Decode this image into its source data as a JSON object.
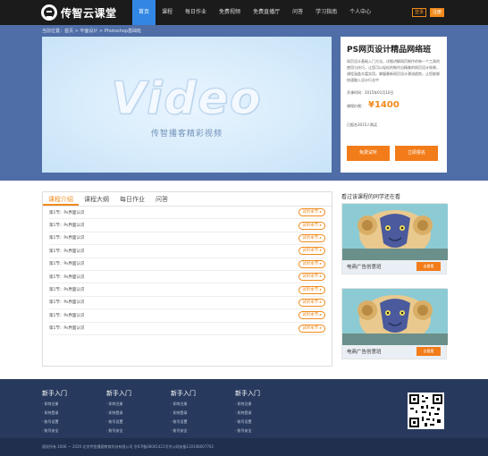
{
  "brand": {
    "name": "传智云课堂"
  },
  "nav": {
    "items": [
      "首页",
      "课程",
      "每日作业",
      "免费视频",
      "免费直播厅",
      "问答",
      "学习指南",
      "个人中心"
    ],
    "active_index": 0,
    "login_label": "登录",
    "register_label": "注册"
  },
  "breadcrumb": "当前位置：首页 > 平面设计 > Photoshop基础班",
  "video": {
    "title": "Video",
    "subtitle": "传智播客精彩视频"
  },
  "course": {
    "title": "PS网页设计精品网络班",
    "description": "网页设计基础入门方法，详细讲解网页制作的每一个工具的使用与技巧，让您可以轻松的制作出精美的网页设计效果，课程涵盖丰富实用，掌握最新网页设计潮流趋势，让您能够快速融入设计行业中",
    "date_label": "开课时间：2015年01月10日",
    "price_label": "课程价格：",
    "price": "¥1400",
    "enrolled": "已报名3015人购买",
    "free_trial_label": "免费试听",
    "enroll_label": "立即报名"
  },
  "tabs": [
    "课程介绍",
    "课程大纲",
    "每日作业",
    "问答"
  ],
  "active_tab": 0,
  "lessons": [
    {
      "title": "第1节：Ps界面认识",
      "action": "试听本节 ▸"
    },
    {
      "title": "第1节：Ps界面认识",
      "action": "试听本节 ▸"
    },
    {
      "title": "第1节：Ps界面认识",
      "action": "试听本节 ▸"
    },
    {
      "title": "第1节：Ps界面认识",
      "action": "试听本节 ▸"
    },
    {
      "title": "第1节：Ps界面认识",
      "action": "试听本节 ▸"
    },
    {
      "title": "第1节：Ps界面认识",
      "action": "试听本节 ▸"
    },
    {
      "title": "第1节：Ps界面认识",
      "action": "试听本节 ▸"
    },
    {
      "title": "第1节：Ps界面认识",
      "action": "试听本节 ▸"
    },
    {
      "title": "第1节：Ps界面认识",
      "action": "试听本节 ▸"
    },
    {
      "title": "第1节：Ps界面认识",
      "action": "试听本节 ▸"
    }
  ],
  "sidebar": {
    "title": "看过该课程的同学还在看",
    "cards": [
      {
        "caption": "电商广告创意班",
        "button": "去看看"
      },
      {
        "caption": "电商广告创意班",
        "button": "去看看"
      }
    ]
  },
  "footer": {
    "columns": [
      {
        "title": "新手入门",
        "items": [
          "如何注册",
          "如何登录",
          "账号设置",
          "账号安全"
        ]
      },
      {
        "title": "新手入门",
        "items": [
          "如何注册",
          "如何登录",
          "账号设置",
          "账号安全"
        ]
      },
      {
        "title": "新手入门",
        "items": [
          "如何注册",
          "如何登录",
          "账号设置",
          "账号安全"
        ]
      },
      {
        "title": "新手入门",
        "items": [
          "如何注册",
          "如何登录",
          "账号设置",
          "账号安全"
        ]
      }
    ],
    "copyright": "版权所有 2006 — 2020 北京传智播客教育科技有限公司 京ICP备08001421号京公网安备110108007702"
  },
  "colors": {
    "nav_bg": "#1b1b1b",
    "nav_active": "#3187e3",
    "accent": "#f08a1c",
    "hero_bg": "#4f6da6",
    "footer_bg": "#27395d"
  }
}
